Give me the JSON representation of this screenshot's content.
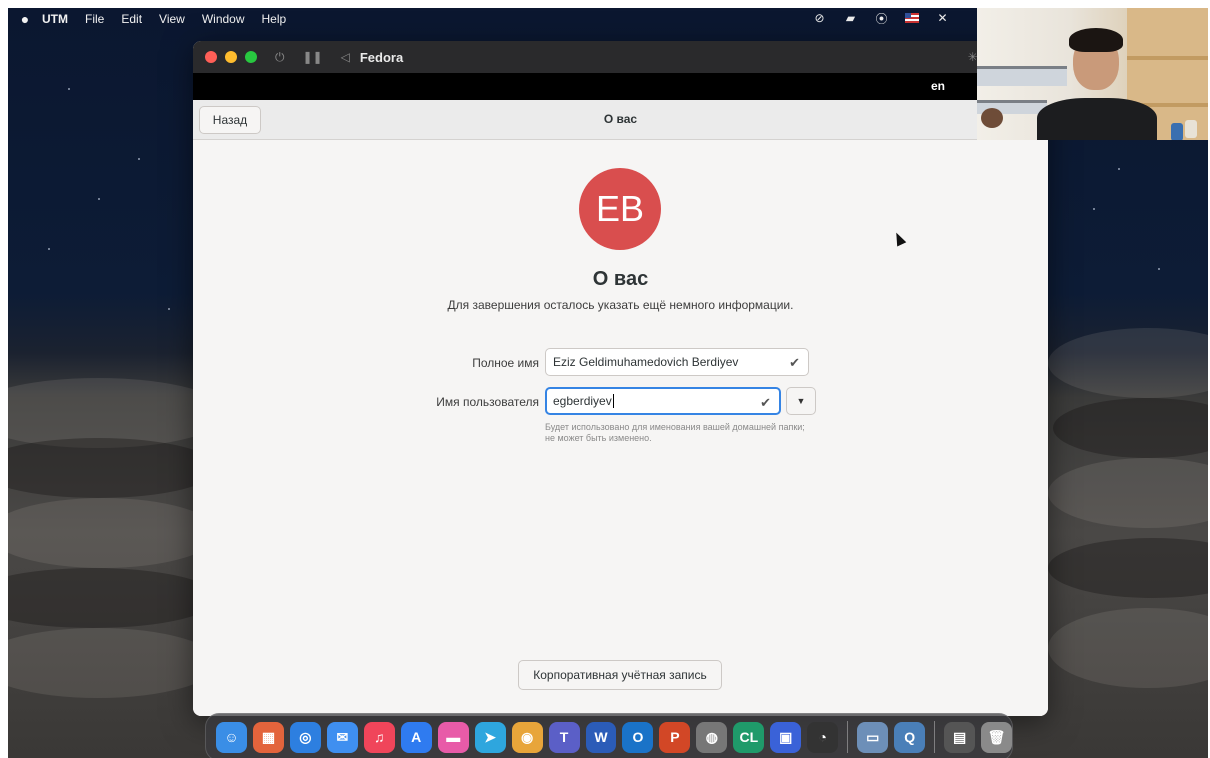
{
  "menubar": {
    "apple": "",
    "app_name": "UTM",
    "items": [
      "File",
      "Edit",
      "View",
      "Window",
      "Help"
    ]
  },
  "utm_window": {
    "title": "Fedora"
  },
  "gnome": {
    "keyboard_layout": "en",
    "header_title": "О вас",
    "back_label": "Назад",
    "avatar_initials": "EB",
    "avatar_color": "#d94e4e",
    "page_title": "О вас",
    "page_subtitle": "Для завершения осталось указать ещё немного информации.",
    "fullname_label": "Полное имя",
    "fullname_value": "Eziz Geldimuhamedovich Berdiyev",
    "username_label": "Имя пользователя",
    "username_value": "egberdiyev",
    "username_hint": "Будет использовано для именования вашей домашней папки; не может быть изменено.",
    "enterprise_login_label": "Корпоративная учётная запись",
    "accent": "#3584e4"
  },
  "dock": {
    "apps": [
      {
        "name": "finder",
        "glyph": "☺",
        "color": "#3a8ee6"
      },
      {
        "name": "launchpad",
        "glyph": "▦",
        "color": "#e3643c"
      },
      {
        "name": "safari",
        "glyph": "◎",
        "color": "#2d7fe0"
      },
      {
        "name": "mail",
        "glyph": "✉",
        "color": "#3f8ff0"
      },
      {
        "name": "music",
        "glyph": "♫",
        "color": "#f0455a"
      },
      {
        "name": "app-store",
        "glyph": "A",
        "color": "#2f7bf0"
      },
      {
        "name": "messages",
        "glyph": "▬",
        "color": "#e85ba8"
      },
      {
        "name": "telegram",
        "glyph": "➤",
        "color": "#2ea6de"
      },
      {
        "name": "chrome",
        "glyph": "◉",
        "color": "#e8a53a"
      },
      {
        "name": "teams",
        "glyph": "T",
        "color": "#5b5fc7"
      },
      {
        "name": "word",
        "glyph": "W",
        "color": "#2b5cb8"
      },
      {
        "name": "outlook",
        "glyph": "O",
        "color": "#1a73c8"
      },
      {
        "name": "powerpoint",
        "glyph": "P",
        "color": "#d24726"
      },
      {
        "name": "disk-utility",
        "glyph": "◍",
        "color": "#777"
      },
      {
        "name": "clion",
        "glyph": "CL",
        "color": "#1f9a6a"
      },
      {
        "name": "utm",
        "glyph": "▣",
        "color": "#3a62d8"
      },
      {
        "name": "obs",
        "glyph": "◔",
        "color": "#333"
      },
      {
        "name": "preview",
        "glyph": "▭",
        "color": "#6d8fb8"
      },
      {
        "name": "quicktime",
        "glyph": "Q",
        "color": "#4a7fb8"
      },
      {
        "name": "downloads",
        "glyph": "▤",
        "color": "#555"
      },
      {
        "name": "trash",
        "glyph": "🗑",
        "color": "#8a8a8a"
      }
    ]
  }
}
